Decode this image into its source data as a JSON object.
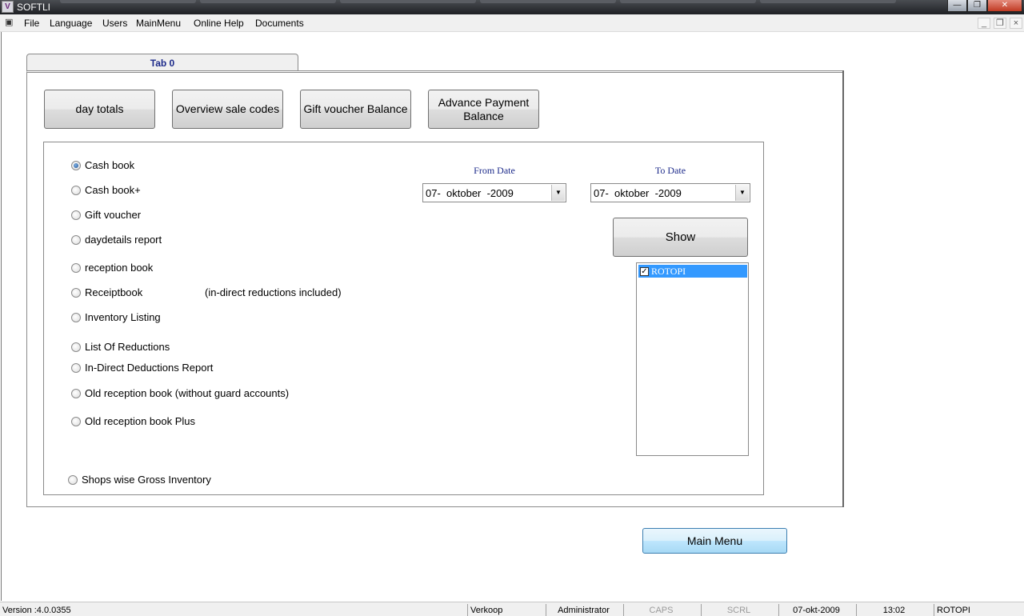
{
  "window": {
    "title": "SOFTLI"
  },
  "menu": {
    "items": [
      "File",
      "Language",
      "Users",
      "MainMenu",
      "Online Help",
      "Documents"
    ]
  },
  "tab": {
    "label": "Tab 0"
  },
  "report_buttons": {
    "day_totals": "day totals",
    "overview_sale_codes": "Overview sale codes",
    "gift_voucher_balance": "Gift voucher Balance",
    "advance_payment_balance": "Advance Payment Balance"
  },
  "reports": {
    "selected": "Cash book",
    "options": [
      "Cash book",
      "Cash book+",
      "Gift voucher",
      "daydetails report",
      "reception book",
      "Receiptbook",
      "Inventory Listing",
      "List Of Reductions",
      "In-Direct Deductions Report",
      "Old reception book (without guard accounts)",
      "Old reception book Plus",
      "Shops wise Gross Inventory"
    ],
    "receiptbook_note": "(in-direct reductions included)"
  },
  "dates": {
    "from_label": "From Date",
    "from_value": "07-  oktober  -2009",
    "to_label": "To Date",
    "to_value": "07-  oktober  -2009"
  },
  "show_button": "Show",
  "shops": [
    {
      "name": "ROTOPI",
      "checked": true
    }
  ],
  "main_menu_button": "Main Menu",
  "status": {
    "version": "Version :4.0.0355",
    "mode": "Verkoop",
    "user": "Administrator",
    "caps": "CAPS",
    "scrl": "SCRL",
    "date": "07-okt-2009",
    "time": "13:02",
    "shop": "ROTOPI"
  }
}
